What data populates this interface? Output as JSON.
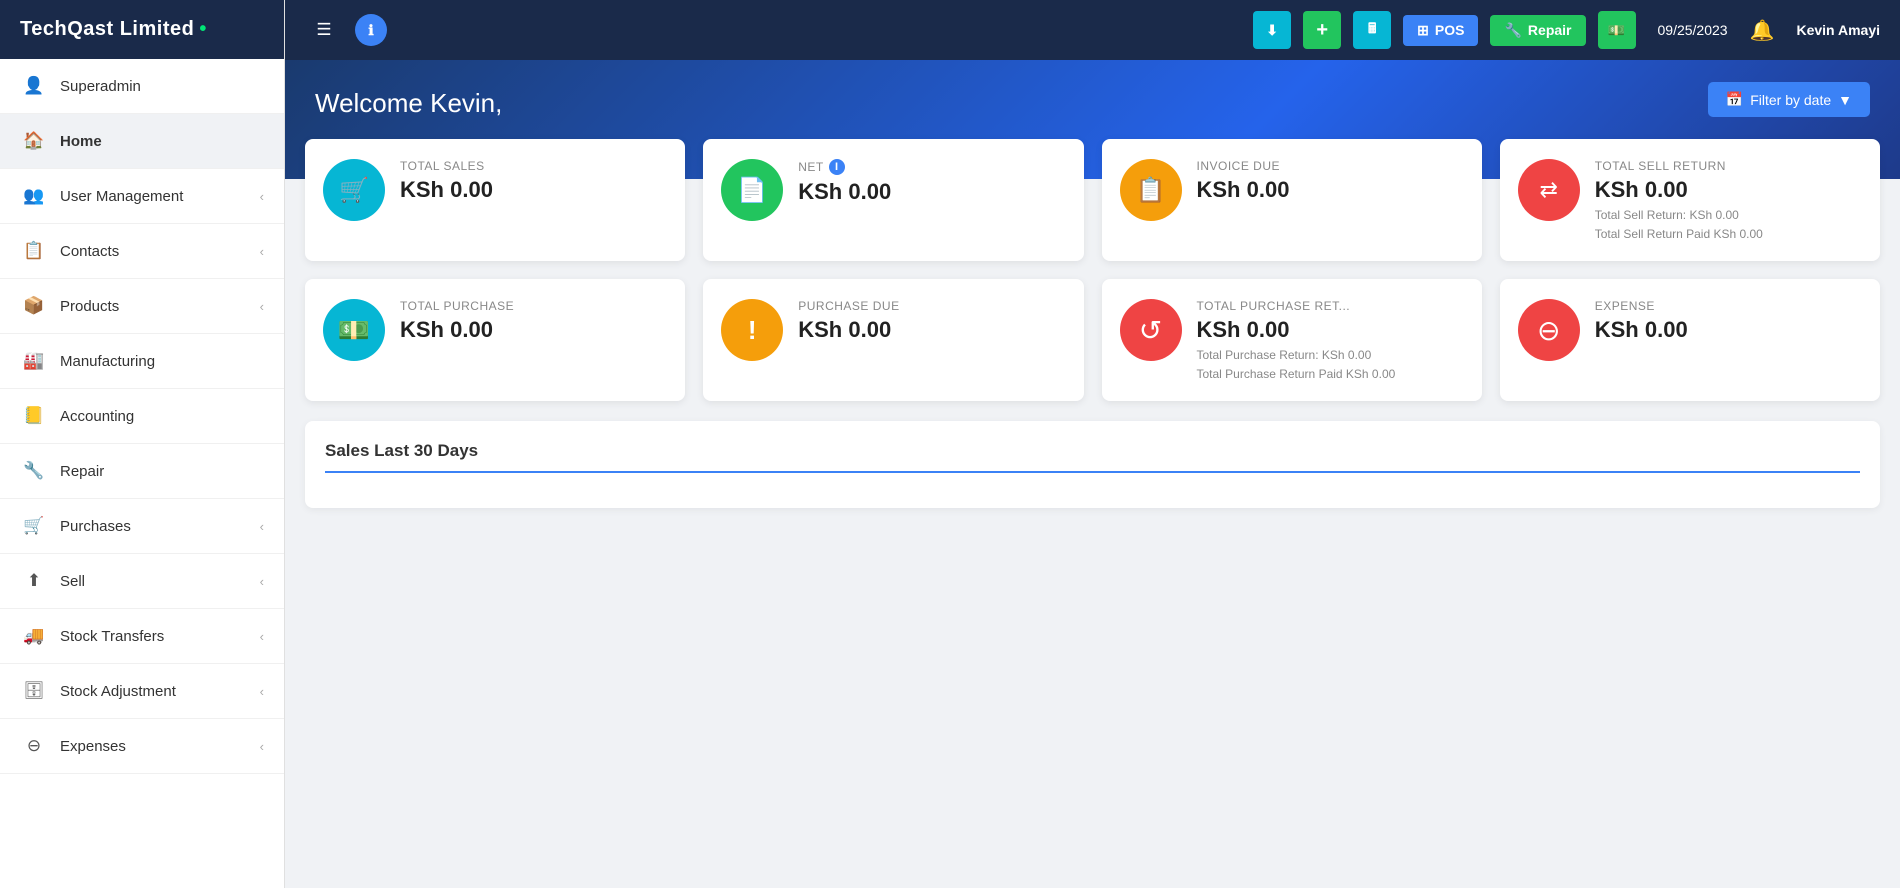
{
  "brand": {
    "name": "TechQast Limited",
    "dot": "•"
  },
  "sidebar": {
    "items": [
      {
        "id": "superadmin",
        "label": "Superadmin",
        "icon": "👤",
        "arrow": false,
        "active": false
      },
      {
        "id": "home",
        "label": "Home",
        "icon": "🏠",
        "arrow": false,
        "active": true
      },
      {
        "id": "user-management",
        "label": "User Management",
        "icon": "👥",
        "arrow": true,
        "active": false
      },
      {
        "id": "contacts",
        "label": "Contacts",
        "icon": "📋",
        "arrow": true,
        "active": false
      },
      {
        "id": "products",
        "label": "Products",
        "icon": "📦",
        "arrow": true,
        "active": false
      },
      {
        "id": "manufacturing",
        "label": "Manufacturing",
        "icon": "🏭",
        "arrow": false,
        "active": false
      },
      {
        "id": "accounting",
        "label": "Accounting",
        "icon": "📒",
        "arrow": false,
        "active": false
      },
      {
        "id": "repair",
        "label": "Repair",
        "icon": "🔧",
        "arrow": false,
        "active": false
      },
      {
        "id": "purchases",
        "label": "Purchases",
        "icon": "🛒",
        "arrow": true,
        "active": false
      },
      {
        "id": "sell",
        "label": "Sell",
        "icon": "⬆",
        "arrow": true,
        "active": false
      },
      {
        "id": "stock-transfers",
        "label": "Stock Transfers",
        "icon": "🚚",
        "arrow": true,
        "active": false
      },
      {
        "id": "stock-adjustment",
        "label": "Stock Adjustment",
        "icon": "🗄",
        "arrow": true,
        "active": false
      },
      {
        "id": "expenses",
        "label": "Expenses",
        "icon": "⊖",
        "arrow": true,
        "active": false
      }
    ]
  },
  "topbar": {
    "menu_icon": "☰",
    "info_icon": "ℹ",
    "btn_download": "⬇",
    "btn_add": "+",
    "btn_calc": "🖩",
    "btn_pos_label": "POS",
    "btn_pos_icon": "⊞",
    "btn_repair_label": "Repair",
    "btn_repair_icon": "🔧",
    "btn_cash_icon": "💵",
    "date": "09/25/2023",
    "bell_icon": "🔔",
    "user": "Kevin Amayi"
  },
  "welcome": {
    "title": "Welcome Kevin,",
    "filter_btn": "Filter by date"
  },
  "stats": {
    "row1": [
      {
        "id": "total-sales",
        "label": "TOTAL SALES",
        "value": "KSh 0.00",
        "icon": "🛒",
        "icon_class": "ic-cyan",
        "has_info": false,
        "subtext": ""
      },
      {
        "id": "net",
        "label": "NET",
        "value": "KSh 0.00",
        "icon": "📄",
        "icon_class": "ic-green",
        "has_info": true,
        "subtext": ""
      },
      {
        "id": "invoice-due",
        "label": "INVOICE DUE",
        "value": "KSh 0.00",
        "icon": "📋",
        "icon_class": "ic-orange",
        "has_info": false,
        "subtext": ""
      },
      {
        "id": "total-sell-return",
        "label": "TOTAL SELL RETURN",
        "value": "KSh 0.00",
        "icon": "⇄",
        "icon_class": "ic-red",
        "has_info": false,
        "subtext1": "Total Sell Return: KSh 0.00",
        "subtext2": "Total Sell Return Paid KSh 0.00"
      }
    ],
    "row2": [
      {
        "id": "total-purchase",
        "label": "TOTAL PURCHASE",
        "value": "KSh 0.00",
        "icon": "💵",
        "icon_class": "ic-cyan",
        "has_info": false,
        "subtext": ""
      },
      {
        "id": "purchase-due",
        "label": "PURCHASE DUE",
        "value": "KSh 0.00",
        "icon": "!",
        "icon_class": "ic-orange",
        "has_info": false,
        "subtext": ""
      },
      {
        "id": "total-purchase-ret",
        "label": "TOTAL PURCHASE RET...",
        "value": "KSh 0.00",
        "icon": "↺",
        "icon_class": "ic-red",
        "has_info": false,
        "subtext1": "Total Purchase Return: KSh 0.00",
        "subtext2": "Total Purchase Return Paid KSh 0.00"
      },
      {
        "id": "expense",
        "label": "EXPENSE",
        "value": "KSh 0.00",
        "icon": "⊖",
        "icon_class": "ic-red",
        "has_info": false,
        "subtext": ""
      }
    ]
  },
  "sales_section": {
    "title": "Sales Last 30 Days"
  }
}
